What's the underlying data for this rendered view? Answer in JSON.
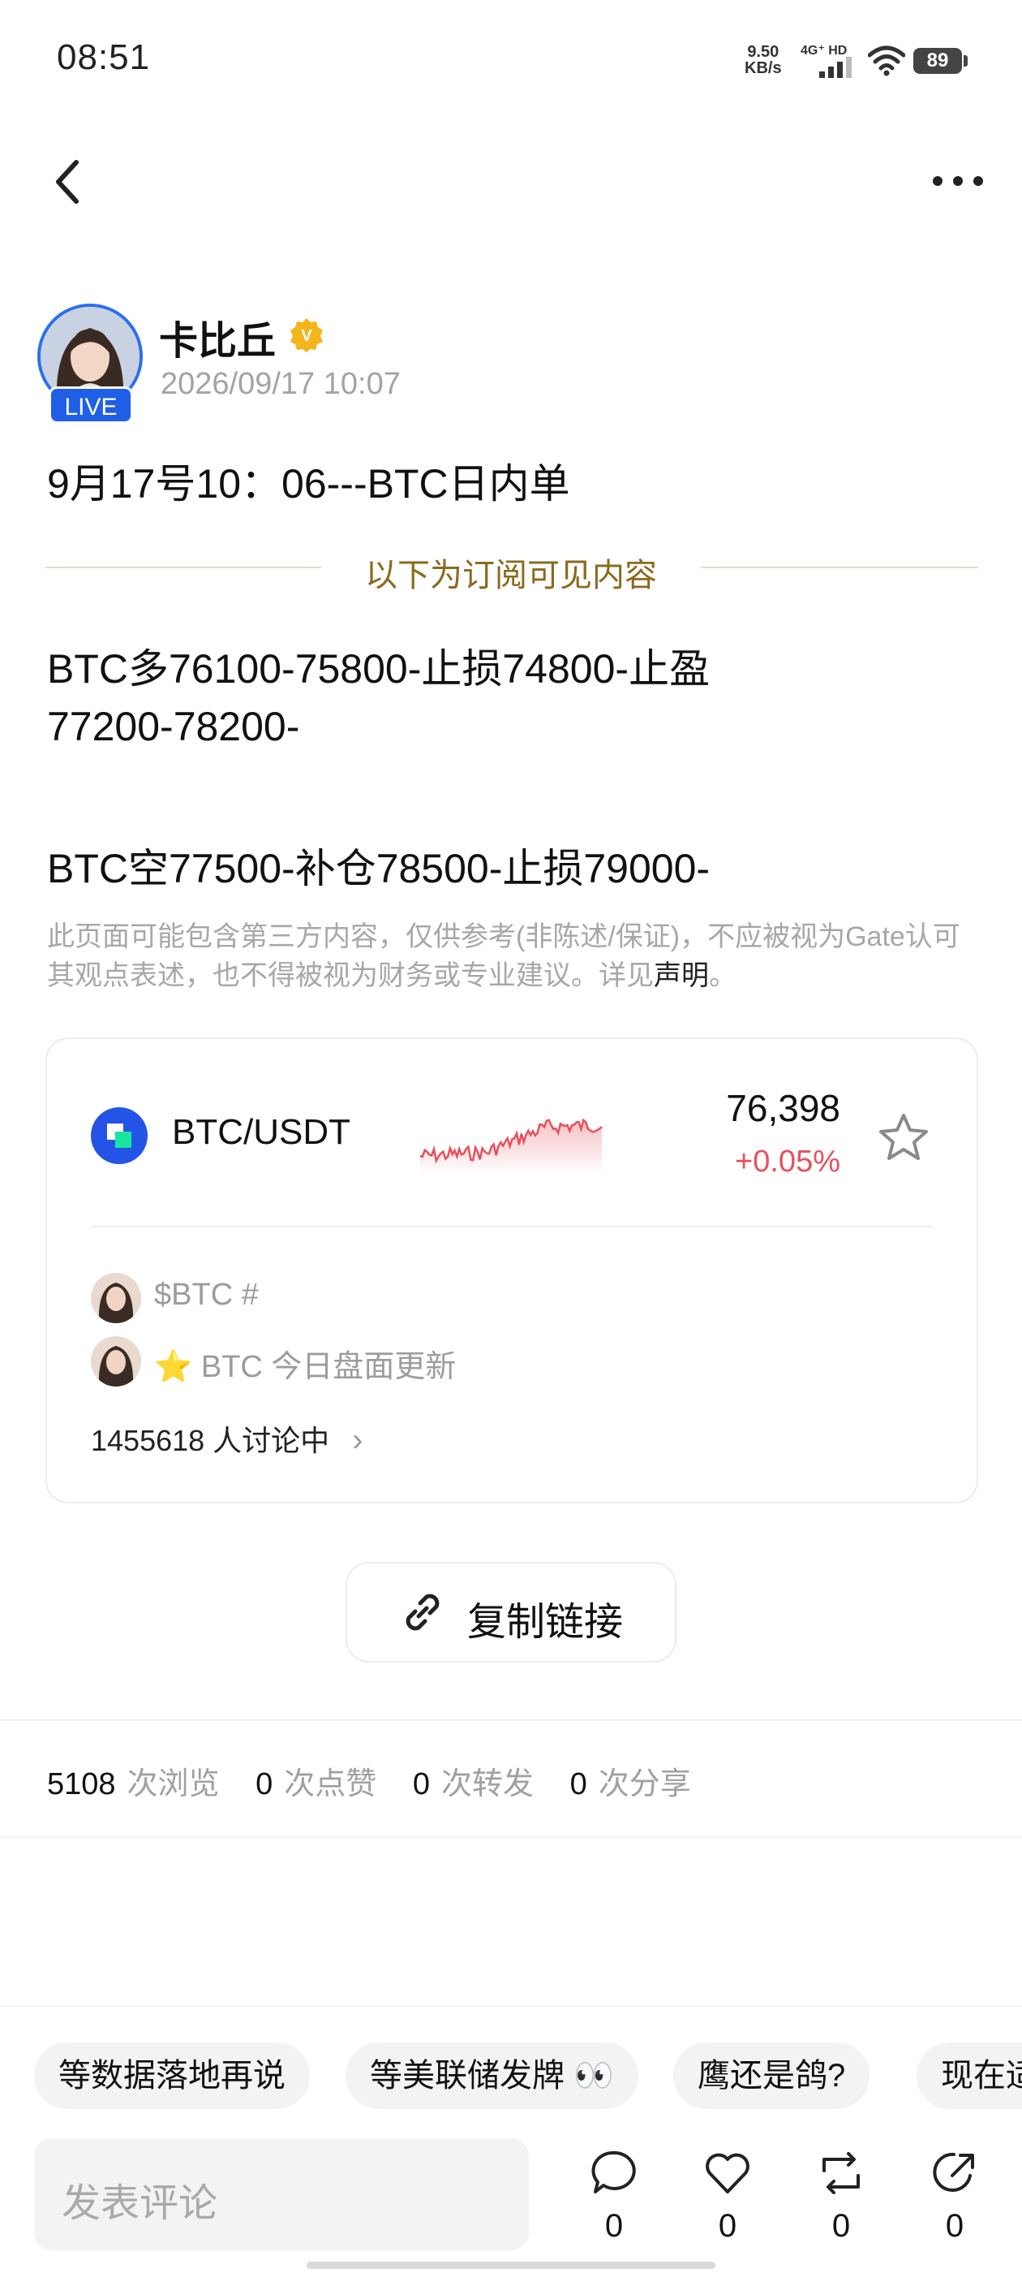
{
  "status_bar": {
    "time": "08:51",
    "net_speed_value": "9.50",
    "net_speed_unit": "KB/s",
    "network": "4G⁺ HD",
    "battery": "89"
  },
  "nav": {
    "back_icon": "chevron-left-icon",
    "more_icon": "more-horizontal-icon"
  },
  "author": {
    "name": "卡比丘",
    "live_badge": "LIVE",
    "verified_badge": "V",
    "timestamp": "2026/09/17 10:07"
  },
  "post": {
    "title": "9月17号10：06---BTC日内单",
    "subscriber_divider": "以下为订阅可见内容",
    "lines": [
      "BTC多76100-75800-止损74800-止盈",
      "77200-78200-",
      "BTC空77500-补仓78500-止损79000-"
    ],
    "disclaimer_text": "此页面可能包含第三方内容，仅供参考(非陈述/保证)，不应被视为Gate认可其观点表述，也不得被视为财务或专业建议。详见",
    "disclaimer_link": "声明",
    "disclaimer_end": "。"
  },
  "market": {
    "pair": "BTC/USDT",
    "price": "76,398",
    "change": "+0.05%",
    "sparkline_color": "#e8505b",
    "topics": [
      "$BTC #",
      "⭐ BTC 今日盘面更新"
    ],
    "discussing": "1455618 人讨论中",
    "discussing_chevron": "›"
  },
  "copy_link": {
    "label": "复制链接"
  },
  "stats": {
    "views": "5108",
    "views_label": "次浏览",
    "likes": "0",
    "likes_label": "次点赞",
    "reposts": "0",
    "reposts_label": "次转发",
    "shares": "0",
    "shares_label": "次分享"
  },
  "chips": [
    "等数据落地再说",
    "等美联储发牌 👀",
    "鹰还是鸽?",
    "现在适"
  ],
  "bottom_bar": {
    "comment_placeholder": "发表评论",
    "comment_count": "0",
    "like_count": "0",
    "repost_count": "0",
    "share_count": "0"
  }
}
